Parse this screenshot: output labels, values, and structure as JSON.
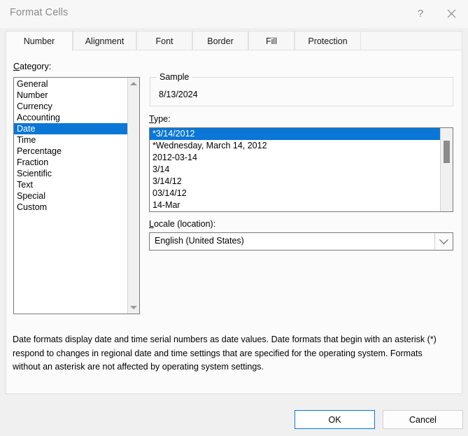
{
  "titlebar": {
    "title": "Format Cells",
    "help_label": "?",
    "close_icon": "close-icon"
  },
  "tabs": [
    {
      "label": "Number",
      "active": true
    },
    {
      "label": "Alignment",
      "active": false
    },
    {
      "label": "Font",
      "active": false
    },
    {
      "label": "Border",
      "active": false
    },
    {
      "label": "Fill",
      "active": false
    },
    {
      "label": "Protection",
      "active": false
    }
  ],
  "category": {
    "label_prefix": "",
    "label_accel": "C",
    "label_rest": "ategory:",
    "items": [
      "General",
      "Number",
      "Currency",
      "Accounting",
      "Date",
      "Time",
      "Percentage",
      "Fraction",
      "Scientific",
      "Text",
      "Special",
      "Custom"
    ],
    "selected": "Date"
  },
  "sample": {
    "legend": "Sample",
    "value": "8/13/2024"
  },
  "type": {
    "label_accel": "T",
    "label_rest": "ype:",
    "items": [
      "*3/14/2012",
      "*Wednesday, March 14, 2012",
      "2012-03-14",
      "3/14",
      "3/14/12",
      "03/14/12",
      "14-Mar"
    ],
    "selected": "*3/14/2012"
  },
  "locale": {
    "label_accel": "L",
    "label_rest": "ocale (location):",
    "value": "English (United States)"
  },
  "description": "Date formats display date and time serial numbers as date values.  Date formats that begin with an asterisk (*) respond to changes in regional date and time settings that are specified for the operating system. Formats without an asterisk are not affected by operating system settings.",
  "footer": {
    "ok_label": "OK",
    "cancel_label": "Cancel"
  },
  "colors": {
    "selection": "#0a76d6",
    "focus_border": "#0a76d6",
    "dialog_bg": "#f0f0f0",
    "panel_bg": "#fbfbfb"
  }
}
